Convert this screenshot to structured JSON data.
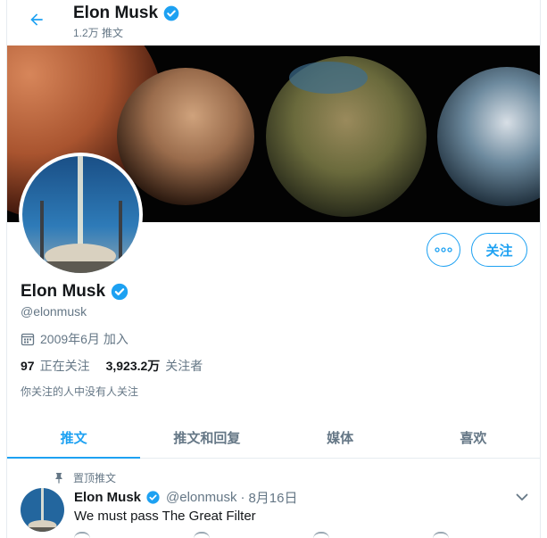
{
  "header": {
    "name": "Elon Musk",
    "tweet_count": "1.2万 推文"
  },
  "profile": {
    "name": "Elon Musk",
    "handle": "@elonmusk",
    "joined": "2009年6月 加入",
    "following_count": "97",
    "following_label": "正在关注",
    "followers_count": "3,923.2万",
    "followers_label": "关注者",
    "followed_by": "你关注的人中没有人关注",
    "follow_button": "关注"
  },
  "tabs": [
    {
      "label": "推文",
      "active": true
    },
    {
      "label": "推文和回复",
      "active": false
    },
    {
      "label": "媒体",
      "active": false
    },
    {
      "label": "喜欢",
      "active": false
    }
  ],
  "pinned_tweet": {
    "pin_label": "置顶推文",
    "name": "Elon Musk",
    "handle": "@elonmusk",
    "separator": "·",
    "date": "8月16日",
    "text": "We must pass The Great Filter"
  },
  "colors": {
    "accent": "#1da1f2",
    "secondary_text": "#657786",
    "primary_text": "#14171a"
  },
  "icons": {
    "back": "arrow-left-icon",
    "verified": "verified-badge-icon",
    "more": "more-horizontal-icon",
    "calendar": "calendar-icon",
    "pin": "pin-icon",
    "caret": "chevron-down-icon"
  }
}
